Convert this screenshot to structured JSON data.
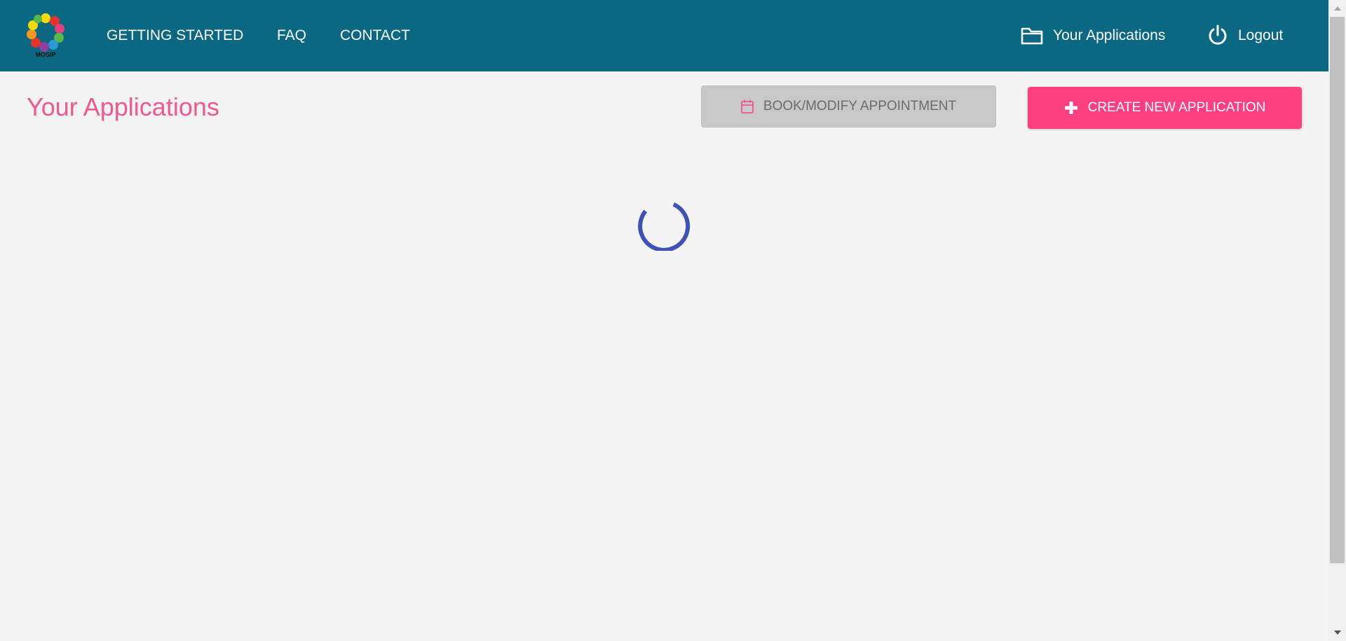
{
  "header": {
    "logo": {
      "icon": "mosip-logo",
      "text": "MOSIP"
    },
    "nav": [
      {
        "label": "GETTING STARTED"
      },
      {
        "label": "FAQ"
      },
      {
        "label": "CONTACT"
      }
    ],
    "your_applications": {
      "label": "Your Applications",
      "icon": "folder-icon"
    },
    "logout": {
      "label": "Logout",
      "icon": "power-icon"
    }
  },
  "main": {
    "title": "Your Applications",
    "book_button": {
      "label": "BOOK/MODIFY APPOINTMENT",
      "icon": "calendar-icon",
      "disabled": true
    },
    "create_button": {
      "label": "CREATE NEW APPLICATION",
      "icon": "plus-icon"
    },
    "loading": true
  },
  "colors": {
    "header_bg": "#0b6882",
    "accent_pink": "#ff4080",
    "title_pink": "#f0588f",
    "spinner": "#3f51b5",
    "disabled_button": "#c8c8c8"
  }
}
